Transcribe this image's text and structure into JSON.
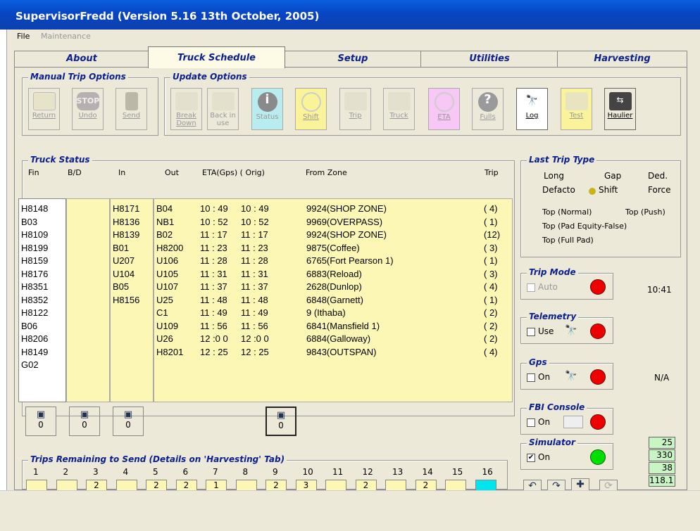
{
  "window": {
    "title": "SupervisorFredd (Version 5.16 13th October, 2005)"
  },
  "menu": [
    "File",
    "Maintenance"
  ],
  "tabs": [
    "About",
    "Truck Schedule",
    "Setup",
    "Utilities",
    "Harvesting"
  ],
  "groups": {
    "manual": "Manual Trip Options",
    "update": "Update Options",
    "truck_status": "Truck Status",
    "last_trip": "Last Trip Type",
    "trip_mode": "Trip Mode",
    "telemetry": "Telemetry",
    "gps": "Gps",
    "fbi": "FBI Console",
    "simulator": "Simulator",
    "trips_remaining": "Trips Remaining to Send (Details on 'Harvesting' Tab)"
  },
  "manual_buttons": [
    "Return",
    "Undo",
    "Send"
  ],
  "update_buttons": [
    "Break Down",
    "Back in use",
    "Status",
    "Shift",
    "Trip",
    "Truck",
    "ETA",
    "Fulls",
    "Log",
    "Test",
    "Haulier"
  ],
  "table": {
    "headers": [
      "Fin",
      "B/D",
      "In",
      "Out",
      "ETA(Gps) ( Orig)",
      "From Zone",
      "Trip"
    ],
    "fin": [
      "H8148",
      "B03",
      "H8109",
      "H8199",
      "H8159",
      "H8176",
      "H8351",
      "H8352",
      "H8122",
      "B06",
      "H8206",
      "H8149",
      "G02"
    ],
    "in": [
      "H8171",
      "H8136",
      "H8139",
      "B01",
      "U207",
      "U104",
      "B05",
      "H8156"
    ],
    "rows": [
      {
        "out": "B04",
        "eta": "10 : 49",
        "orig": "10 : 49",
        "zone": "9924(SHOP ZONE)",
        "trip": "(  4)"
      },
      {
        "out": "NB1",
        "eta": "10 : 52",
        "orig": "10 : 52",
        "zone": "9969(OVERPASS)",
        "trip": "(  1)"
      },
      {
        "out": "B02",
        "eta": "11 : 17",
        "orig": "11 : 17",
        "zone": "9924(SHOP ZONE)",
        "trip": "(12)"
      },
      {
        "out": "H8200",
        "eta": "11 : 23",
        "orig": "11 : 23",
        "zone": "9875(Coffee)",
        "trip": "(  3)"
      },
      {
        "out": "U106",
        "eta": "11 : 28",
        "orig": "11 : 28",
        "zone": "6765(Fort Pearson 1)",
        "trip": "(  1)"
      },
      {
        "out": "U105",
        "eta": "11 : 31",
        "orig": "11 : 31",
        "zone": "6883(Reload)",
        "trip": "(  3)"
      },
      {
        "out": "U107",
        "eta": "11 : 37",
        "orig": "11 : 37",
        "zone": "2628(Dunlop)",
        "trip": "(  4)"
      },
      {
        "out": "U25",
        "eta": "11 : 48",
        "orig": "11 : 48",
        "zone": "6848(Garnett)",
        "trip": "(  1)"
      },
      {
        "out": "C1",
        "eta": "11 : 49",
        "orig": "11 : 49",
        "zone": "9  (Ithaba)",
        "trip": "(  2)"
      },
      {
        "out": "U109",
        "eta": "11 : 56",
        "orig": "11 : 56",
        "zone": "6841(Mansfield 1)",
        "trip": "(  2)"
      },
      {
        "out": "U26",
        "eta": "12 :0 0",
        "orig": "12 :0 0",
        "zone": "6884(Galloway)",
        "trip": "(  2)"
      },
      {
        "out": "H8201",
        "eta": "12 : 25",
        "orig": "12 : 25",
        "zone": "9843(OUTSPAN)",
        "trip": "(  4)"
      }
    ]
  },
  "cam_counts": [
    "0",
    "0",
    "0",
    "0"
  ],
  "last_trip": {
    "r1": [
      "Long",
      "Gap",
      "Ded."
    ],
    "r2": [
      "Defacto",
      "Shift",
      "Force"
    ],
    "top_normal": "Top (Normal)",
    "top_push": "Top (Push)",
    "top_pad_eq": "Top (Pad Equity-False)",
    "top_full": "Top (Full Pad)"
  },
  "trip_mode": {
    "auto": "Auto",
    "time": "10:41"
  },
  "telemetry": {
    "use": "Use"
  },
  "gps": {
    "on": "On",
    "status": "N/A"
  },
  "fbi": {
    "on": "On"
  },
  "simulator": {
    "on": "On",
    "checked": "✔"
  },
  "trips_remaining": {
    "numbers": [
      "1",
      "2",
      "3",
      "4",
      "5",
      "6",
      "7",
      "8",
      "9",
      "10",
      "11",
      "12",
      "13",
      "14",
      "15",
      "16"
    ],
    "values": [
      "",
      "",
      "2",
      "",
      "2",
      "2",
      "1",
      "",
      "2",
      "3",
      "",
      "2",
      "",
      "2",
      "",
      ""
    ]
  },
  "green_values": [
    "25",
    "330",
    "38",
    "118.1"
  ],
  "colors": {
    "title_blue": "#0a5fdc",
    "group_title": "#0a1f8f",
    "yellow": "#fdf7b6",
    "led_red": "#ee0000",
    "led_green": "#00dd00",
    "cyan": "#00e5ee"
  }
}
